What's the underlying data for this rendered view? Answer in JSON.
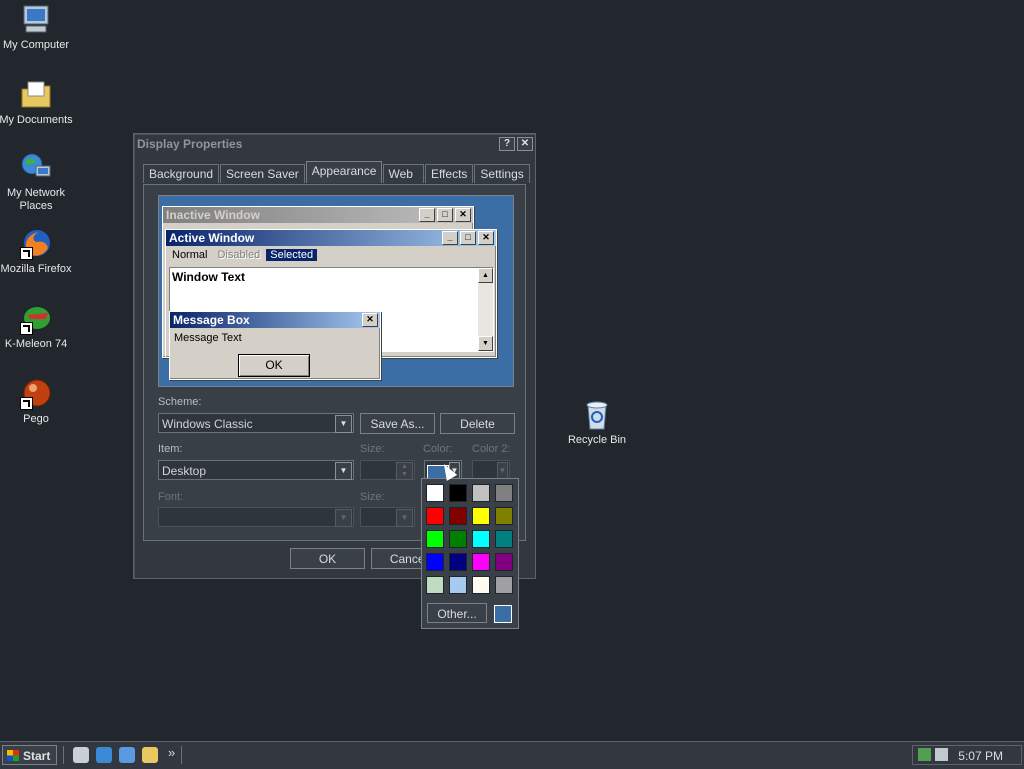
{
  "desktop": {
    "icons": [
      {
        "label": "My Computer",
        "icon": "my-computer-icon"
      },
      {
        "label": "My Documents",
        "icon": "my-documents-icon"
      },
      {
        "label": "My Network Places",
        "icon": "network-places-icon"
      },
      {
        "label": "Mozilla Firefox",
        "icon": "firefox-icon"
      },
      {
        "label": "K-Meleon 74",
        "icon": "k-meleon-icon"
      },
      {
        "label": "Pego",
        "icon": "pego-icon"
      },
      {
        "label": "Recycle Bin",
        "icon": "recycle-bin-icon"
      }
    ]
  },
  "dialog": {
    "title": "Display Properties",
    "help_glyph": "?",
    "close_glyph": "✕",
    "tabs": [
      {
        "label": "Background"
      },
      {
        "label": "Screen Saver"
      },
      {
        "label": "Appearance"
      },
      {
        "label": "Web"
      },
      {
        "label": "Effects"
      },
      {
        "label": "Settings"
      }
    ],
    "active_tab": "Appearance",
    "preview": {
      "inactive_title": "Inactive Window",
      "active_title": "Active Window",
      "menu": {
        "normal": "Normal",
        "disabled": "Disabled",
        "selected": "Selected"
      },
      "window_text": "Window Text",
      "msgbox_title": "Message Box",
      "msgbox_text": "Message Text",
      "ok": "OK"
    },
    "scheme_label": "Scheme:",
    "scheme_value": "Windows Classic",
    "save_as": "Save As...",
    "delete": "Delete",
    "item_label": "Item:",
    "item_value": "Desktop",
    "size_label": "Size:",
    "color_label": "Color:",
    "color2_label": "Color 2:",
    "font_label": "Font:",
    "font_size_label": "Size:",
    "ok": "OK",
    "cancel": "Cancel"
  },
  "palette": {
    "colors": [
      "#ffffff",
      "#000000",
      "#c0c0c0",
      "#808080",
      "#ff0000",
      "#800000",
      "#ffff00",
      "#808000",
      "#00ff00",
      "#008000",
      "#00ffff",
      "#008080",
      "#0000ff",
      "#000080",
      "#ff00ff",
      "#800080",
      "#c0dcc0",
      "#a6caf0",
      "#fffbf0",
      "#a0a0a4"
    ],
    "other_label": "Other...",
    "current": "#3a6ea5"
  },
  "taskbar": {
    "start_label": "Start",
    "chevron": "»",
    "clock": "5:07 PM"
  }
}
